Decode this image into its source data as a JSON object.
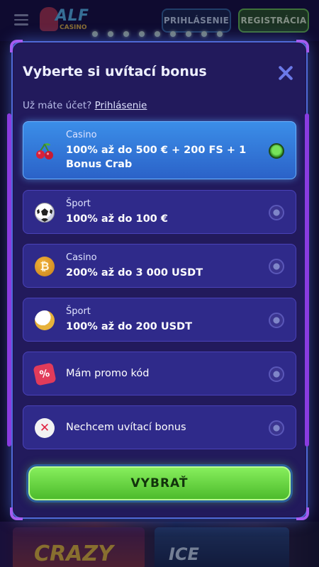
{
  "header": {
    "logo_text": "ALF",
    "logo_sub": "CASINO",
    "login_label": "PRIHLÁSENIE",
    "register_label": "REGISTRÁCIA"
  },
  "background": {
    "game_1": "CRAZY",
    "game_2": "ICE"
  },
  "dialog": {
    "title": "Vyberte si uvítací bonus",
    "account_prompt": "Už máte účet?",
    "account_link": "Prihlásenie",
    "options": [
      {
        "category": "Casino",
        "text": "100% až do 500 € + 200 FS + 1 Bonus Crab",
        "icon": "cherry-icon",
        "selected": true
      },
      {
        "category": "Šport",
        "text": "100% až do 100 €",
        "icon": "soccer-ball-icon",
        "selected": false
      },
      {
        "category": "Casino",
        "text": "200% až do 3 000 USDT",
        "icon": "bitcoin-icon",
        "selected": false
      },
      {
        "category": "Šport",
        "text": "100% až do 200 USDT",
        "icon": "bitcoin-ball-icon",
        "selected": false
      },
      {
        "category": "",
        "text": "Mám promo kód",
        "icon": "promo-percent-icon",
        "selected": false
      },
      {
        "category": "",
        "text": "Nechcem uvítací bonus",
        "icon": "no-bonus-icon",
        "selected": false
      }
    ],
    "submit_label": "VYBRAŤ"
  },
  "colors": {
    "dialog_bg": "#221a5c",
    "option_bg": "#2f2a8a",
    "selected_bg": "#3b8ee8",
    "submit_green": "#6fdc4a",
    "accent_purple": "#8a3be0"
  }
}
